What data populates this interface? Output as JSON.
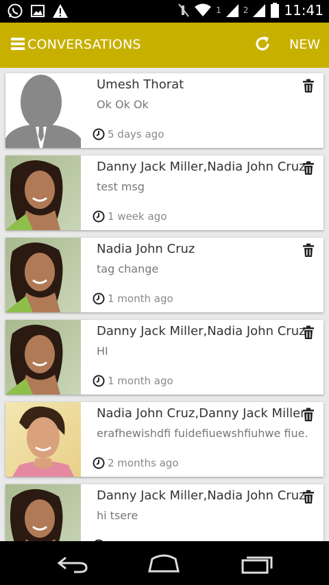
{
  "status_bar": {
    "time": "11:41",
    "sim1": "1",
    "sim2": "2",
    "left_icons": [
      "whatsapp-icon",
      "image-icon",
      "warning-icon"
    ],
    "right_icons": [
      "mute-icon",
      "wifi-icon",
      "signal-icon",
      "signal-icon",
      "battery-icon"
    ]
  },
  "app_bar": {
    "title": "CONVERSATIONS",
    "new_label": "NEW",
    "background": "#c8b000"
  },
  "conversations": [
    {
      "name": "Umesh Thorat",
      "message": "Ok Ok Ok",
      "time": "5 days ago",
      "avatar": "placeholder"
    },
    {
      "name": "Danny Jack Miller,Nadia John Cruz",
      "message": "test msg",
      "time": "1 week ago",
      "avatar": "woman"
    },
    {
      "name": "Nadia John Cruz",
      "message": "tag change",
      "time": "1 month ago",
      "avatar": "woman"
    },
    {
      "name": "Danny Jack Miller,Nadia John Cruz",
      "message": "HI",
      "time": "1 month ago",
      "avatar": "woman"
    },
    {
      "name": "Nadia John Cruz,Danny Jack Miller",
      "message": "erafhewishdfi fuidefiuewshfiuhwe fiue...",
      "time": "2 months ago",
      "avatar": "man"
    },
    {
      "name": "Danny Jack Miller,Nadia John Cruz",
      "message": "hi tsere",
      "time": "",
      "avatar": "woman"
    }
  ],
  "nav_bar": {
    "buttons": [
      "back-icon",
      "home-icon",
      "recents-icon"
    ]
  }
}
